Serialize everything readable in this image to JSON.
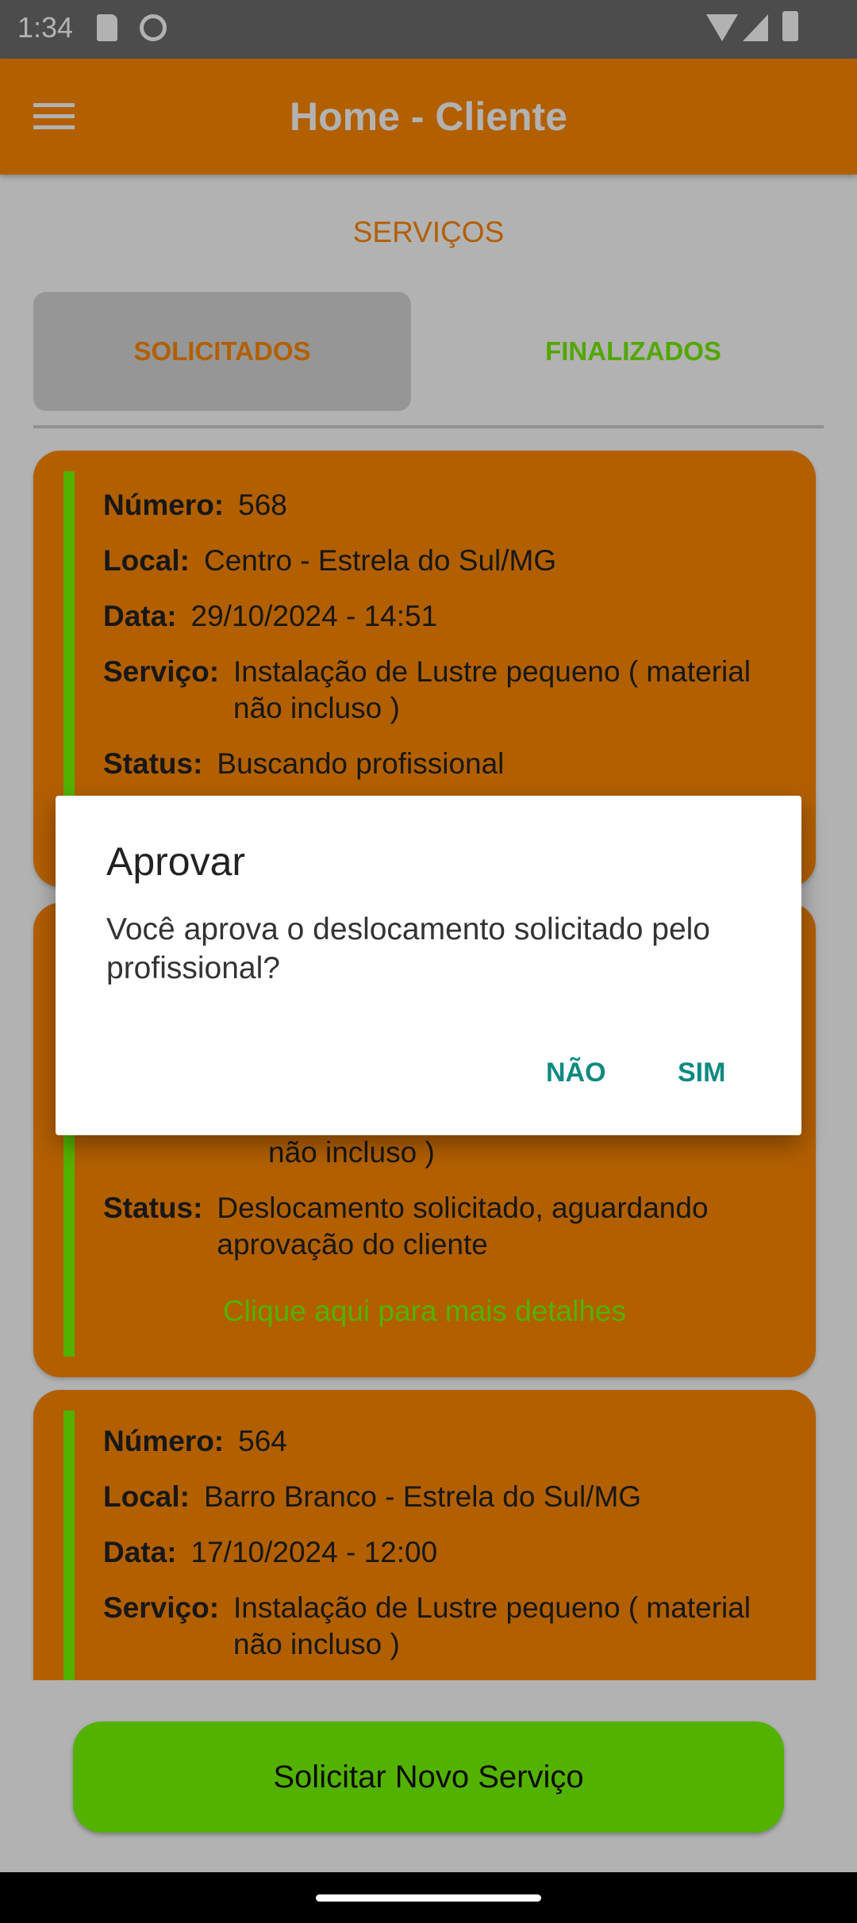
{
  "status_bar": {
    "time": "1:34",
    "icons": [
      "sd-card-icon",
      "face-icon",
      "wifi-icon",
      "signal-icon",
      "battery-icon"
    ]
  },
  "app_bar": {
    "title": "Home - Cliente",
    "menu_icon": "menu-icon"
  },
  "section_title": "SERVIÇOS",
  "tabs": [
    {
      "label": "SOLICITADOS",
      "selected": true
    },
    {
      "label": "FINALIZADOS",
      "selected": false
    }
  ],
  "labels": {
    "numero": "Número:",
    "local": "Local:",
    "data": "Data:",
    "servico": "Serviço:",
    "status": "Status:"
  },
  "cards": [
    {
      "numero": "568",
      "local": "Centro - Estrela do Sul/MG",
      "data": "29/10/2024 - 14:51",
      "servico": "Instalação de Lustre pequeno ( material não incluso )",
      "status": "Buscando profissional"
    },
    {
      "servico_tail": "não incluso )",
      "status": "Deslocamento solicitado, aguardando aprovação do cliente",
      "link": "Clique aqui para mais detalhes"
    },
    {
      "numero": "564",
      "local": "Barro Branco  - Estrela do Sul/MG",
      "data": "17/10/2024 - 12:00",
      "servico": "Instalação de Lustre pequeno ( material não incluso )"
    }
  ],
  "dialog": {
    "title": "Aprovar",
    "message": "Você aprova o deslocamento solicitado pelo profissional?",
    "negative": "NÃO",
    "positive": "SIM"
  },
  "bottom_button": "Solicitar Novo Serviço",
  "colors": {
    "primary": "#ff8800",
    "accent_green": "#77ff00",
    "dialog_button": "#0f8a80"
  }
}
